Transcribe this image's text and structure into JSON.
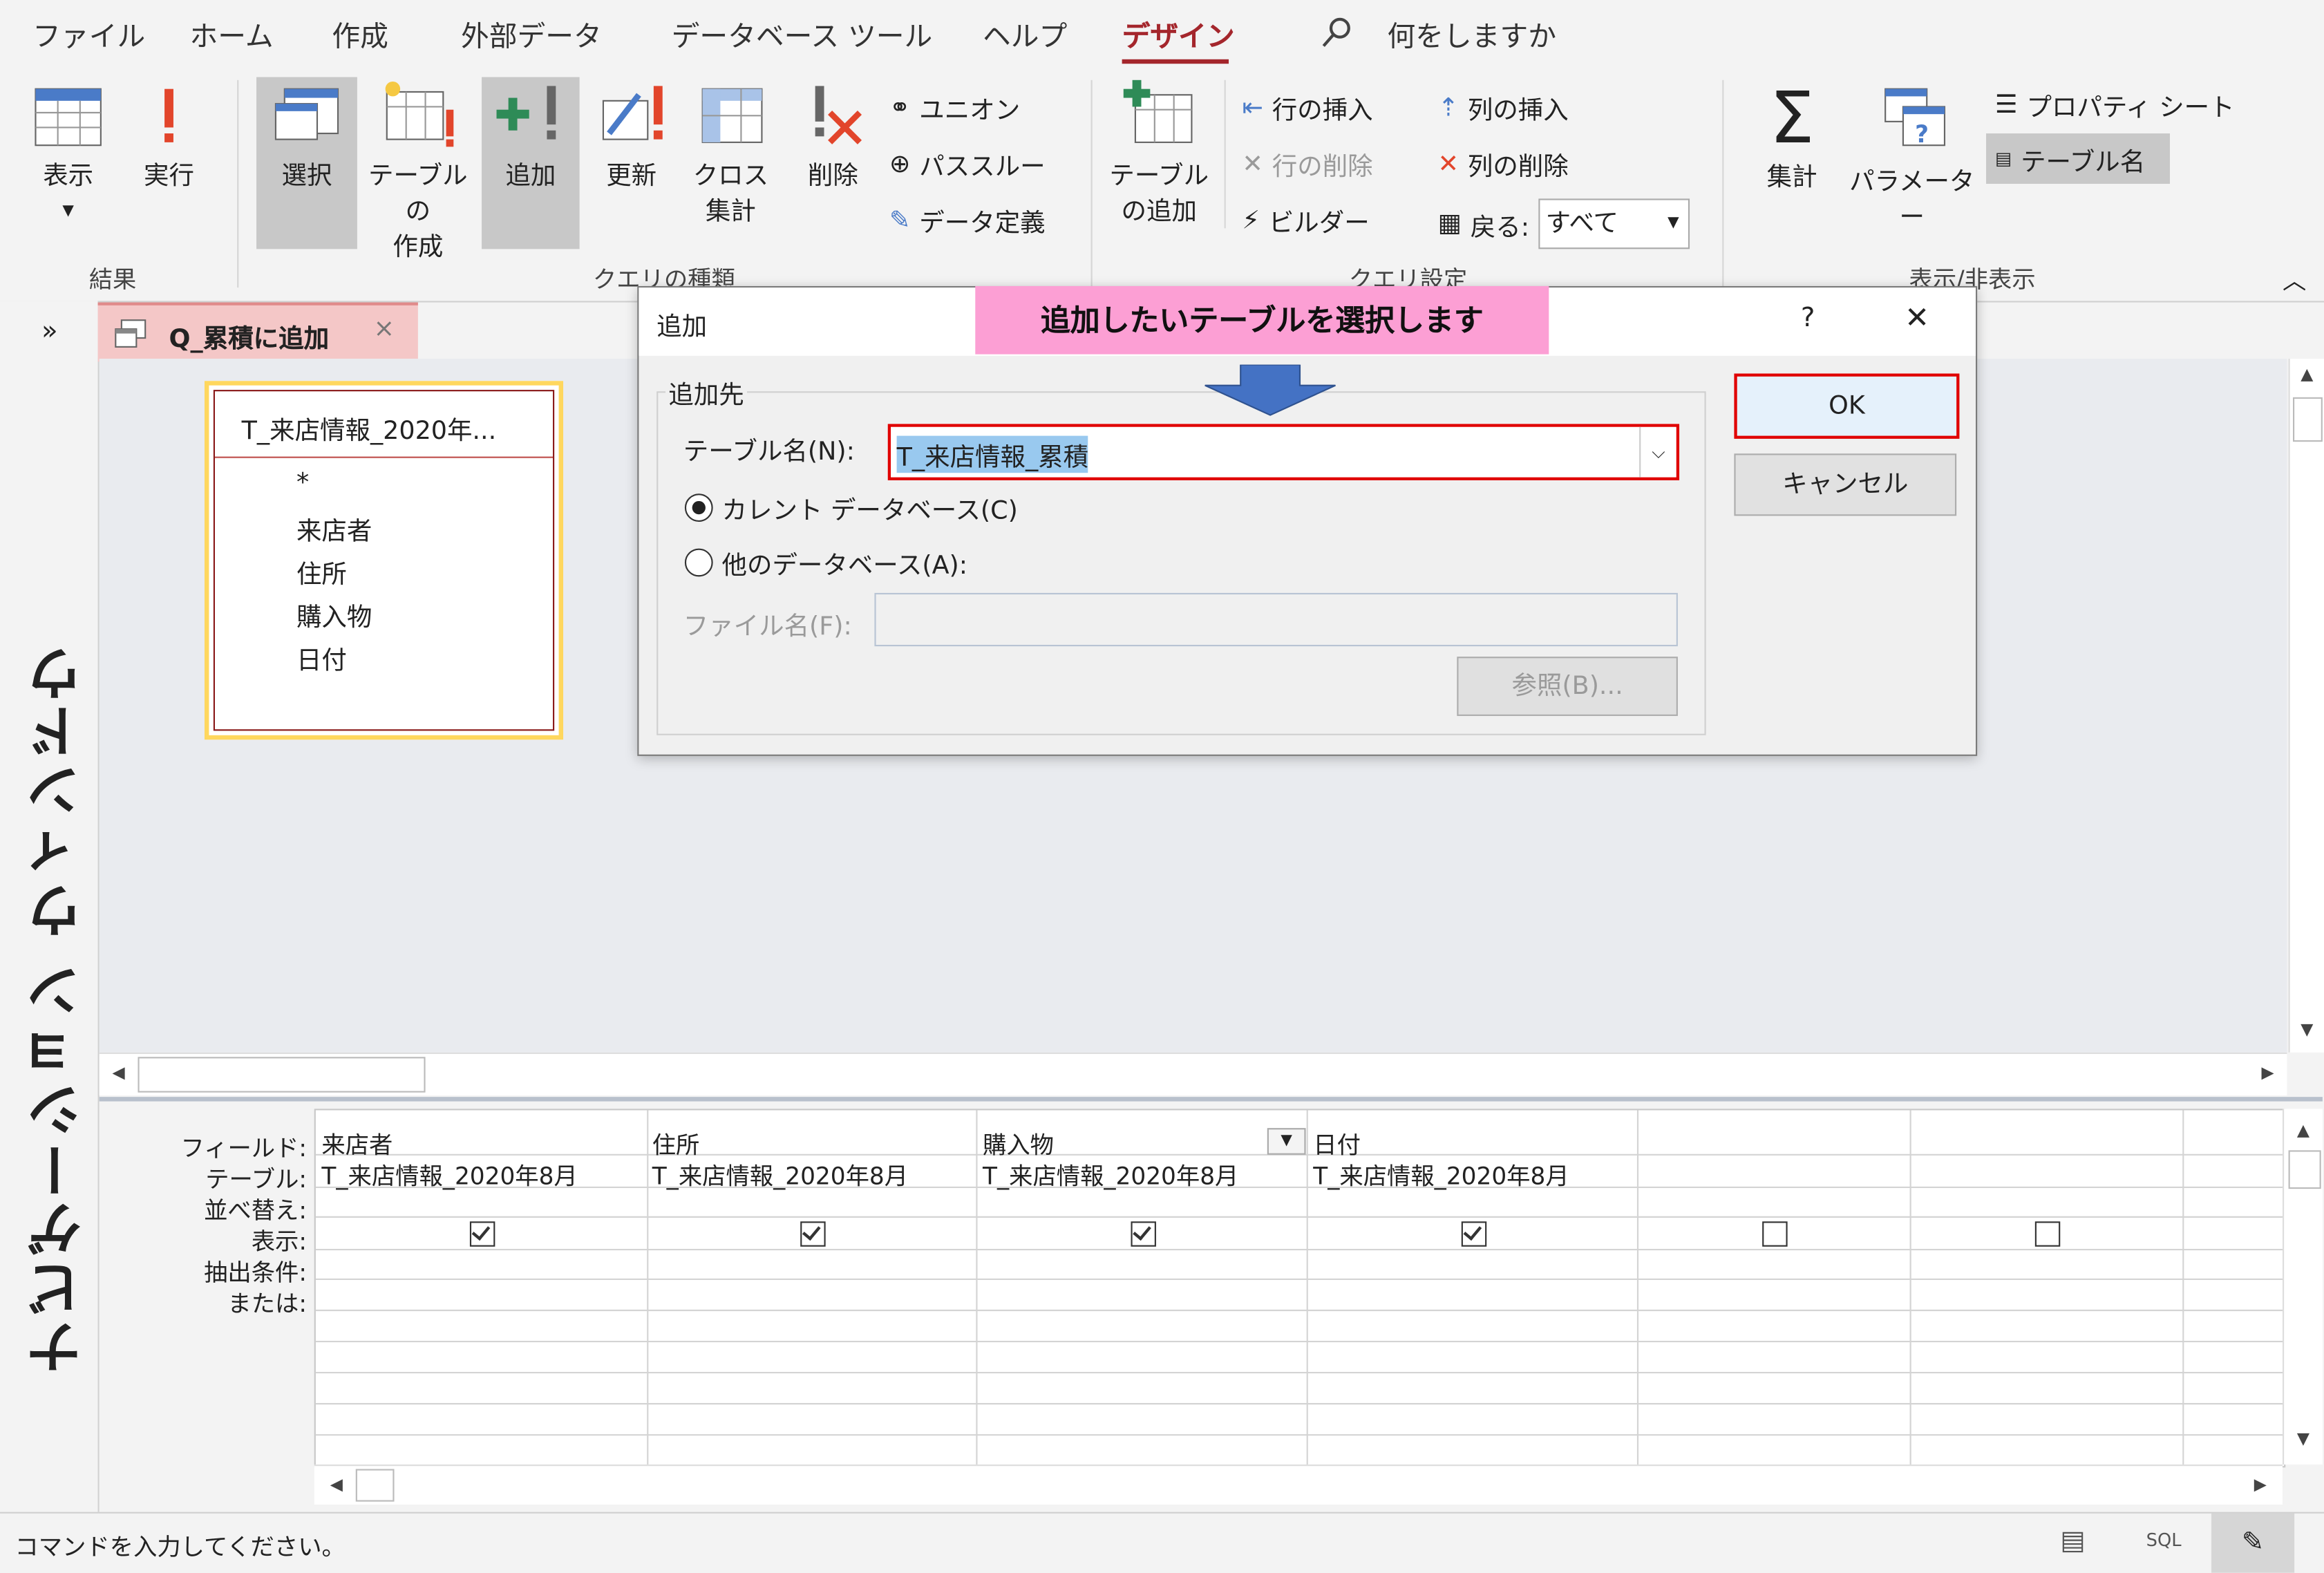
{
  "menu": {
    "items": [
      "ファイル",
      "ホーム",
      "作成",
      "外部データ",
      "データベース ツール",
      "ヘルプ"
    ],
    "active": "デザイン",
    "search_placeholder": "何をしますか"
  },
  "ribbon": {
    "results": {
      "view": "表示",
      "run": "実行",
      "group": "結果"
    },
    "query_type": {
      "select": "選択",
      "make_table_1": "テーブルの",
      "make_table_2": "作成",
      "append": "追加",
      "update": "更新",
      "crosstab_1": "クロス",
      "crosstab_2": "集計",
      "delete": "削除",
      "union": "ユニオン",
      "passthrough": "パススルー",
      "data_definition": "データ定義",
      "group": "クエリの種類"
    },
    "query_setup": {
      "add_table_1": "テーブル",
      "add_table_2": "の追加",
      "insert_rows": "行の挿入",
      "delete_rows": "行の削除",
      "builder": "ビルダー",
      "insert_columns": "列の挿入",
      "delete_columns": "列の削除",
      "return_label": "戻る:",
      "return_value": "すべて",
      "group": "クエリ設定"
    },
    "show_hide": {
      "totals": "集計",
      "parameters": "パラメーター",
      "property_sheet": "プロパティ シート",
      "table_names": "テーブル名",
      "group": "表示/非表示"
    }
  },
  "nav": {
    "title": "ナビゲーション ウィンドウ",
    "expand": "»"
  },
  "tab": {
    "label": "Q_累積に追加",
    "close": "×"
  },
  "table_box": {
    "title": "T_来店情報_2020年...",
    "fields": [
      "*",
      "来店者",
      "住所",
      "購入物",
      "日付"
    ]
  },
  "grid": {
    "row_labels": [
      "フィールド:",
      "テーブル:",
      "並べ替え:",
      "表示:",
      "抽出条件:",
      "または:"
    ],
    "columns": [
      {
        "field": "来店者",
        "table": "T_来店情報_2020年8月",
        "show": true
      },
      {
        "field": "住所",
        "table": "T_来店情報_2020年8月",
        "show": true
      },
      {
        "field": "購入物",
        "table": "T_来店情報_2020年8月",
        "show": true
      },
      {
        "field": "日付",
        "table": "T_来店情報_2020年8月",
        "show": true
      },
      {
        "field": "",
        "table": "",
        "show": false
      },
      {
        "field": "",
        "table": "",
        "show": false
      }
    ]
  },
  "status": {
    "text": "コマンドを入力してください。",
    "sql": "SQL"
  },
  "dialog": {
    "title": "追加",
    "help": "?",
    "close": "✕",
    "callout": "追加したいテーブルを選択します",
    "group_label": "追加先",
    "table_name_label": "テーブル名(N):",
    "table_name_value": "T_来店情報_累積",
    "current_db": "カレント データベース(C)",
    "other_db": "他のデータベース(A):",
    "file_name_label": "ファイル名(F):",
    "browse": "参照(B)...",
    "ok": "OK",
    "cancel": "キャンセル",
    "highlight_color": "#e00000"
  }
}
